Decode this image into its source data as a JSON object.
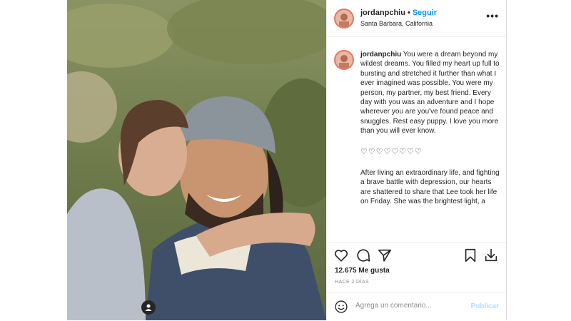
{
  "post": {
    "username": "jordanpchiu",
    "separator": "•",
    "follow_label": "Seguir",
    "location": "Santa Barbara, California",
    "more_icon": "ellipsis-icon",
    "more_label": "•••"
  },
  "caption": {
    "username": "jordanpchiu",
    "text": "You were a dream beyond my wildest dreams. You filled my heart up full to bursting and stretched it further than what I ever imagined was possible. You were my person, my partner, my best friend. Every day with you was an adventure and I hope wherever you are you've found peace and snuggles. Rest easy puppy. I love you more than you will ever know.",
    "hearts": "♡♡♡♡♡♡♡♡",
    "paragraph2": "After living an extraordinary life, and fighting a brave battle with depression, our hearts are shattered to share that Lee took her life on Friday. She was the brightest light, a"
  },
  "actions": {
    "like_icon": "heart-icon",
    "comment_icon": "comment-icon",
    "share_icon": "send-icon",
    "save_icon": "bookmark-icon",
    "download_icon": "download-icon"
  },
  "likes_text": "12.675 Me gusta",
  "timestamp": "HACE 2 DÍAS",
  "comment_box": {
    "placeholder": "Agrega un comentario...",
    "publish_label": "Publicar",
    "emoji_icon": "smiley-icon"
  },
  "colors": {
    "link_blue": "#0095f6",
    "publish_disabled": "#b2dffc",
    "avatar_ring": "#e8745f",
    "muted_text": "#8e8e8e"
  }
}
